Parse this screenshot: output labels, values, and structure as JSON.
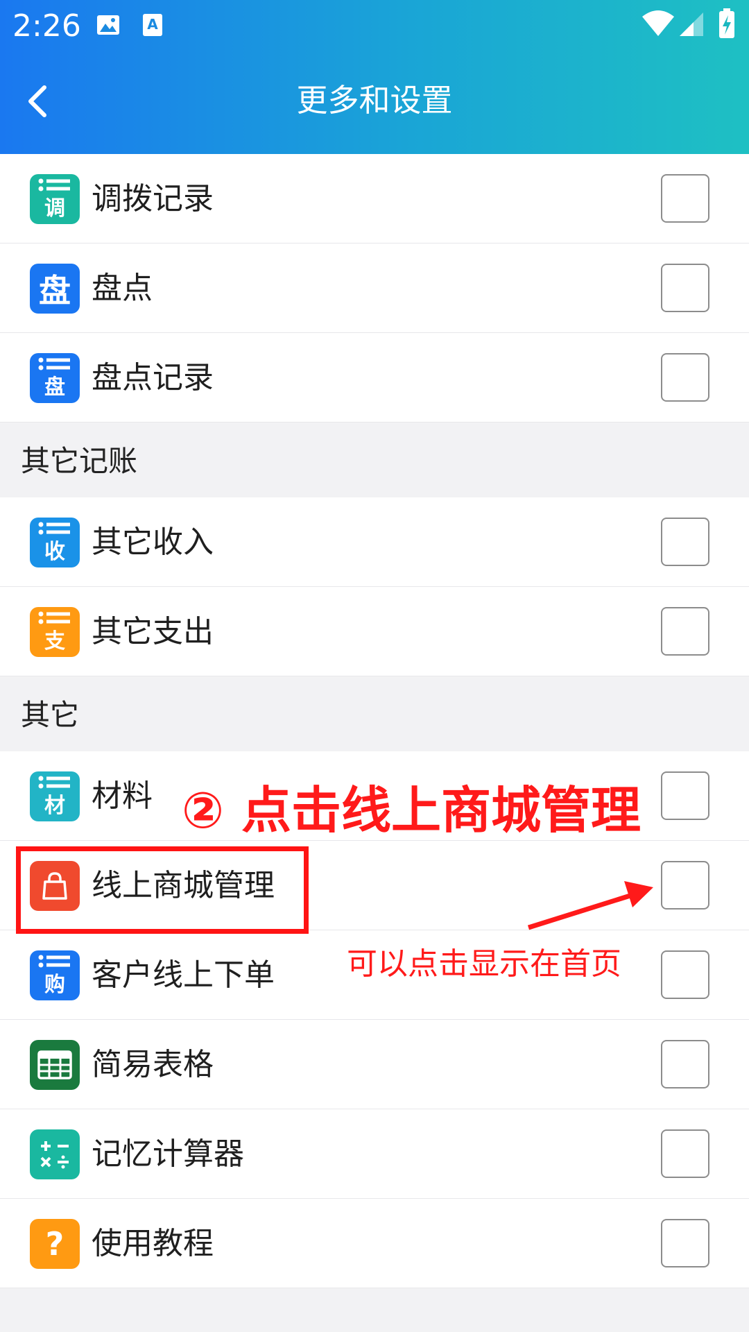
{
  "status_bar": {
    "time": "2:26"
  },
  "app_bar": {
    "title": "更多和设置"
  },
  "sections": [
    {
      "header": null,
      "items": [
        {
          "label": "调拨记录",
          "icon": "list-transfer-icon",
          "icon_char": "调",
          "color": "#1ab8a0",
          "checked": false
        },
        {
          "label": "盘点",
          "icon": "inventory-icon",
          "icon_char": "盘",
          "color": "#1a76f2",
          "checked": false
        },
        {
          "label": "盘点记录",
          "icon": "list-inventory-icon",
          "icon_char": "盘",
          "color": "#1a76f2",
          "checked": false
        }
      ]
    },
    {
      "header": "其它记账",
      "items": [
        {
          "label": "其它收入",
          "icon": "list-income-icon",
          "icon_char": "收",
          "color": "#1a92e8",
          "checked": false
        },
        {
          "label": "其它支出",
          "icon": "list-expense-icon",
          "icon_char": "支",
          "color": "#ff9a12",
          "checked": false
        }
      ]
    },
    {
      "header": "其它",
      "items": [
        {
          "label": "材料",
          "icon": "list-material-icon",
          "icon_char": "材",
          "color": "#22b4c6",
          "checked": false
        },
        {
          "label": "线上商城管理",
          "icon": "shopping-bag-icon",
          "icon_char": "",
          "color": "#f04a2e",
          "checked": false
        },
        {
          "label": "客户线上下单",
          "icon": "list-purchase-icon",
          "icon_char": "购",
          "color": "#1a76f2",
          "checked": false
        },
        {
          "label": "简易表格",
          "icon": "table-icon",
          "icon_char": "",
          "color": "#1a7a3e",
          "checked": false
        },
        {
          "label": "记忆计算器",
          "icon": "calculator-icon",
          "icon_char": "",
          "color": "#1ab8a0",
          "checked": false
        },
        {
          "label": "使用教程",
          "icon": "help-icon",
          "icon_char": "?",
          "color": "#ff9a12",
          "checked": false
        }
      ]
    }
  ],
  "annotations": {
    "step_title": "② 点击线上商城管理",
    "note": "可以点击显示在首页",
    "color": "#ff1a1a"
  }
}
